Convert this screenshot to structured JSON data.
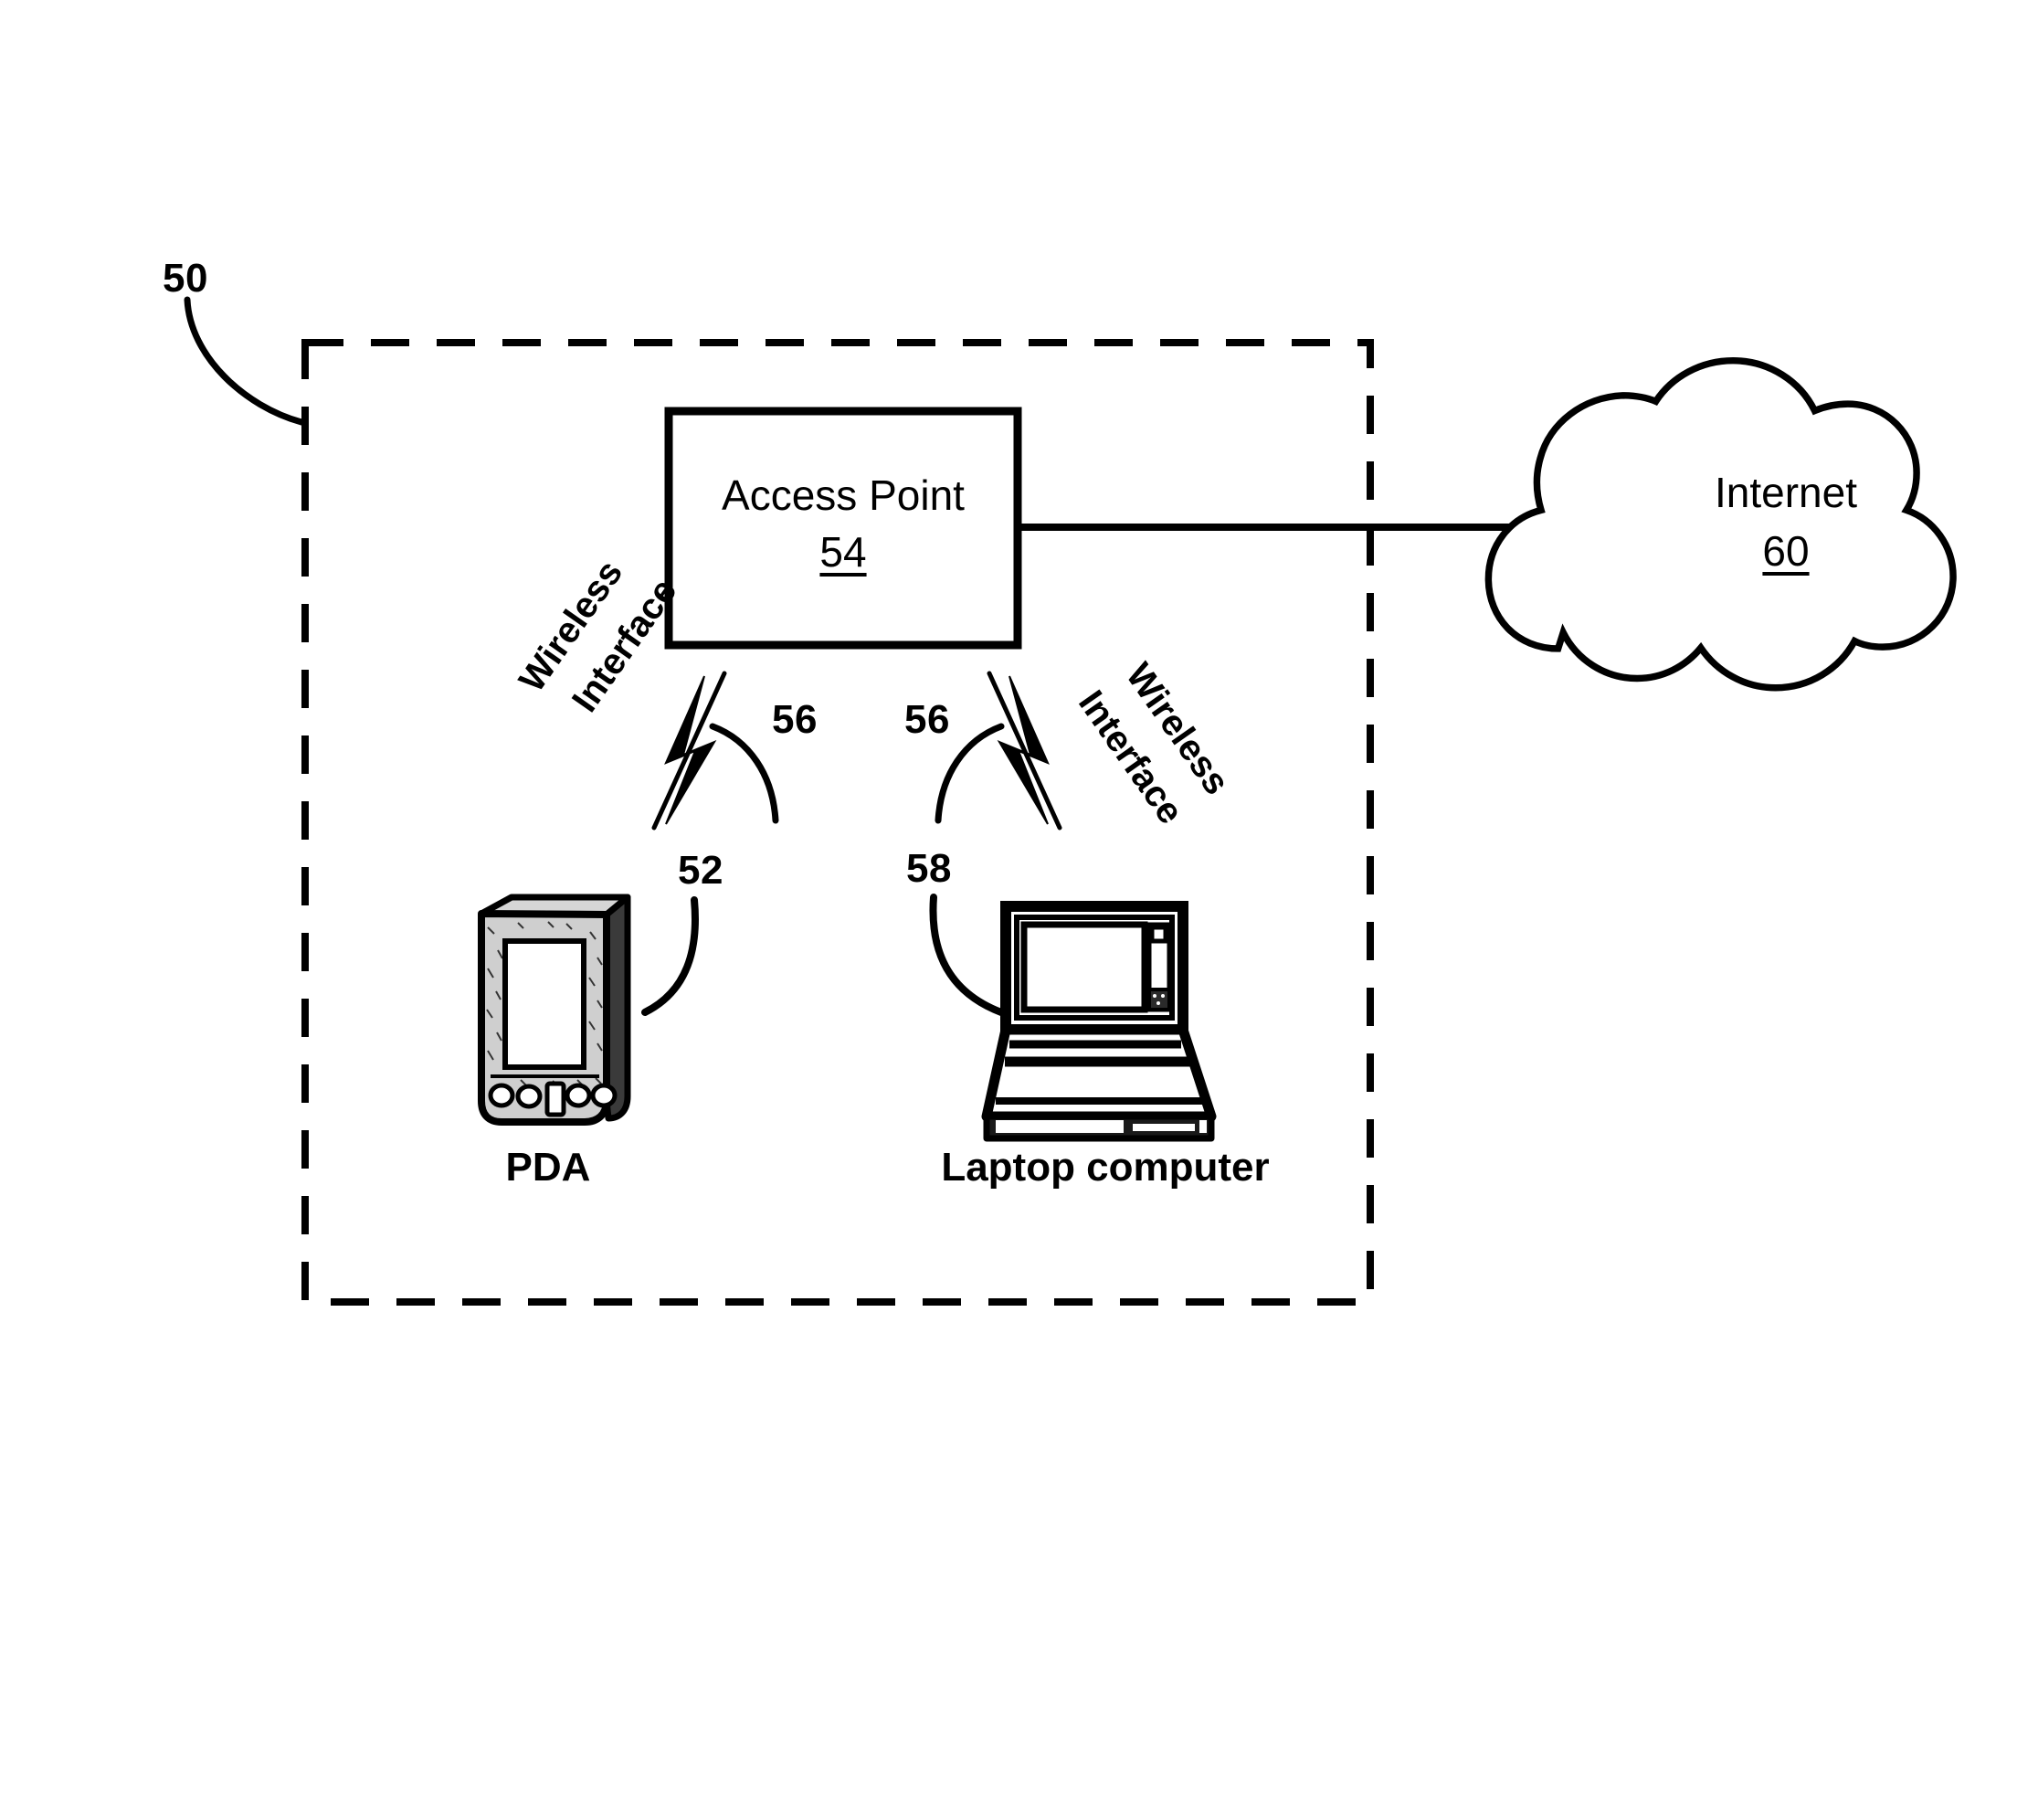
{
  "figure": {
    "type": "patent-network-diagram",
    "background_color": "#ffffff",
    "line_color": "#000000"
  },
  "reference_numerals": {
    "network_boundary": "50",
    "pda": "52",
    "access_point": "54",
    "wireless_interface_left": "56",
    "wireless_interface_right": "56",
    "laptop": "58",
    "internet": "60"
  },
  "boundary": {
    "name": "wireless-lan-boundary",
    "label": "50",
    "style": "dashed"
  },
  "nodes": {
    "access_point": {
      "title": "Access Point",
      "numeral": "54",
      "shape": "rectangle"
    },
    "internet": {
      "title": "Internet",
      "numeral": "60",
      "shape": "cloud"
    },
    "pda": {
      "caption": "PDA",
      "numeral": "52",
      "shape": "handheld-device"
    },
    "laptop": {
      "caption": "Laptop computer",
      "numeral": "58",
      "shape": "laptop-computer"
    }
  },
  "links": {
    "wireless_left": {
      "label_line1": "Wireless",
      "label_line2": "Interface",
      "numeral": "56",
      "icon": "lightning-bolt"
    },
    "wireless_right": {
      "label_line1": "Wireless",
      "label_line2": "Interface",
      "numeral": "56",
      "icon": "lightning-bolt"
    },
    "wired_to_internet": {
      "style": "solid-line"
    }
  }
}
